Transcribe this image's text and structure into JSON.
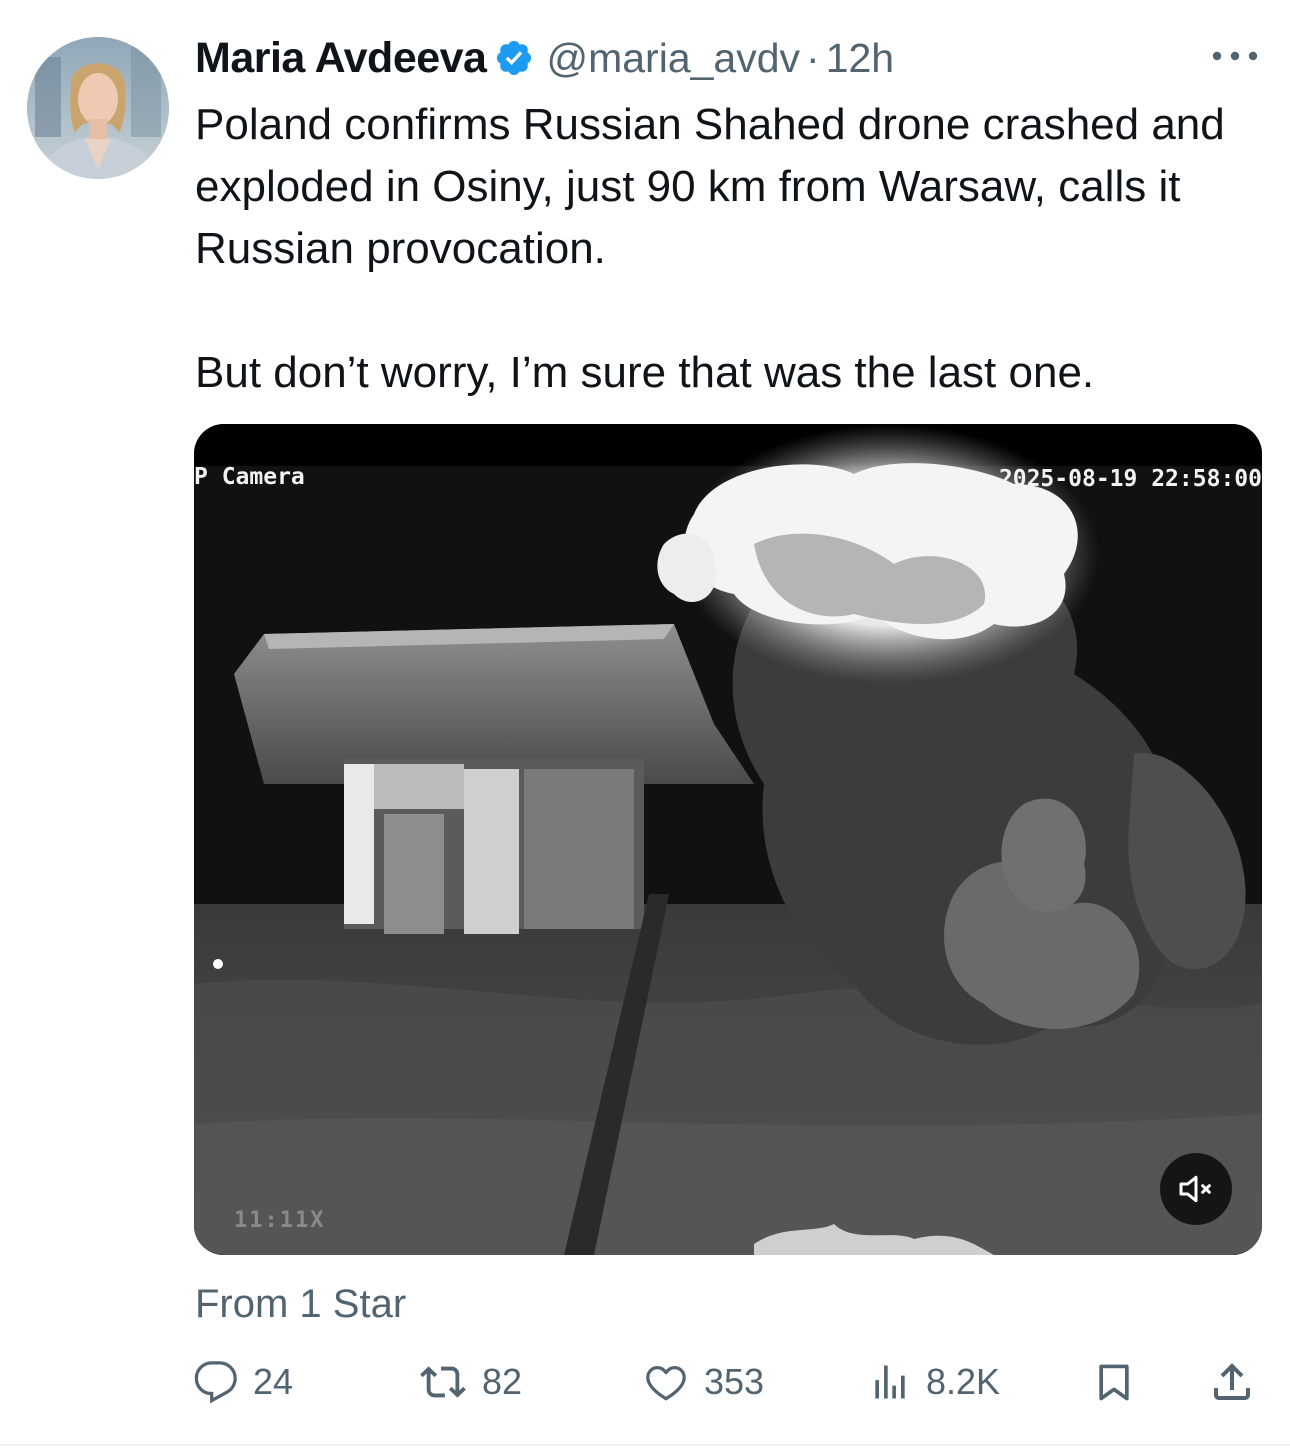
{
  "tweet": {
    "author": {
      "name": "Maria Avdeeva",
      "handle": "@maria_avdv",
      "verified": true,
      "verified_color": "#1d9bf0"
    },
    "separator": "·",
    "time": "12h",
    "more_icon": "more-horizontal-icon",
    "text_paragraphs": [
      "Poland confirms Russian Shahed drone crashed and exploded in Osiny, just 90 km from Warsaw, calls it Russian provocation.",
      "But don’t worry, I’m sure that was the last one."
    ],
    "media": {
      "type": "video",
      "overlay_top_left": "P Camera",
      "overlay_top_right": "2025-08-19 22:58:00",
      "overlay_bottom_left": "11:11X",
      "mute_icon": "volume-muted-icon"
    },
    "source": "From 1 Star",
    "actions": {
      "replies": "24",
      "reposts": "82",
      "likes": "353",
      "views": "8.2K",
      "reply_icon": "reply-icon",
      "repost_icon": "repost-icon",
      "like_icon": "heart-icon",
      "views_icon": "views-icon",
      "bookmark_icon": "bookmark-icon",
      "share_icon": "share-icon"
    }
  },
  "colors": {
    "text_primary": "#0f1419",
    "text_secondary": "#536471",
    "accent": "#1d9bf0"
  }
}
